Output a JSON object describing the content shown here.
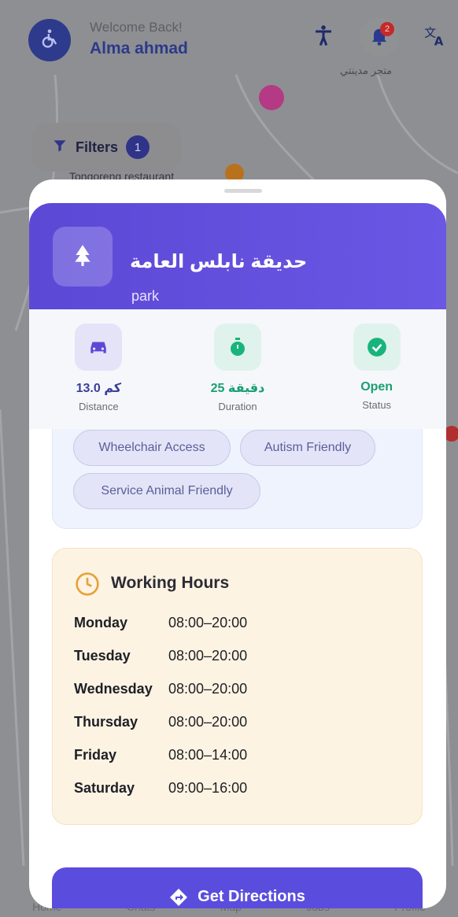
{
  "header": {
    "welcome": "Welcome Back!",
    "username": "Alma ahmad",
    "notification_count": "2",
    "icons": [
      "wheelchair-icon",
      "accessibility-icon",
      "bell-icon",
      "translate-icon"
    ]
  },
  "map": {
    "filters_label": "Filters",
    "filters_count": "1",
    "labels": {
      "restaurant": "Tongoreng restaurant",
      "shop": "متجر مدينتي"
    }
  },
  "place": {
    "name": "حديقة نابلس العامة",
    "type": "park",
    "icon": "tree-icon"
  },
  "stats": [
    {
      "value": "13.0 كم",
      "label": "Distance",
      "icon": "car-icon",
      "color": "#5b49d6"
    },
    {
      "value": "25 دقيقة",
      "label": "Duration",
      "icon": "timer-icon",
      "color": "#19b47c"
    },
    {
      "value": "Open",
      "label": "Status",
      "icon": "check-circle-icon",
      "color": "#19b47c"
    }
  ],
  "features": [
    "Wheelchair Access",
    "Autism Friendly",
    "Service Animal Friendly"
  ],
  "working_hours": {
    "title": "Working Hours",
    "days": [
      {
        "day": "Monday",
        "time": "08:00–20:00"
      },
      {
        "day": "Tuesday",
        "time": "08:00–20:00"
      },
      {
        "day": "Wednesday",
        "time": "08:00–20:00"
      },
      {
        "day": "Thursday",
        "time": "08:00–20:00"
      },
      {
        "day": "Friday",
        "time": "08:00–14:00"
      },
      {
        "day": "Saturday",
        "time": "09:00–16:00"
      }
    ]
  },
  "directions_label": "Get Directions",
  "bottom_nav": [
    "Home",
    "Chats",
    "Map",
    "Jobs",
    "Profile"
  ],
  "colors": {
    "primary": "#5b49d6",
    "success": "#19b47c",
    "hours_bg": "#fdf3e2",
    "hours_icon": "#e5a23a"
  }
}
